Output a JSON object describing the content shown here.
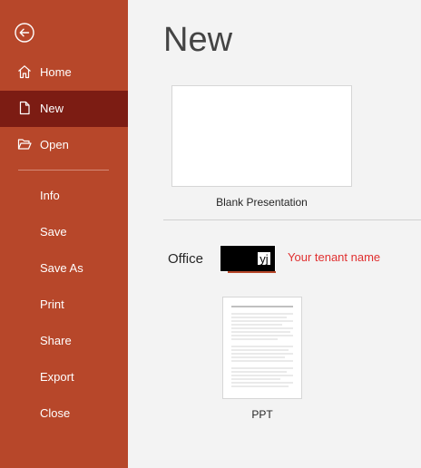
{
  "colors": {
    "sidebar": "#b7472a",
    "sidebar_active": "#7c1c13",
    "main_bg": "#f3f3f3",
    "annotation": "#e03030"
  },
  "sidebar": {
    "back_icon": "back-arrow-circle-icon",
    "items": [
      {
        "label": "Home",
        "icon": "home-icon"
      },
      {
        "label": "New",
        "icon": "document-icon",
        "active": true
      },
      {
        "label": "Open",
        "icon": "folder-open-icon"
      },
      {
        "label": "Info"
      },
      {
        "label": "Save"
      },
      {
        "label": "Save As"
      },
      {
        "label": "Print"
      },
      {
        "label": "Share"
      },
      {
        "label": "Export"
      },
      {
        "label": "Close"
      }
    ]
  },
  "main": {
    "title": "New",
    "blank_template": {
      "caption": "Blank Presentation"
    },
    "tabs": [
      {
        "label": "Office"
      },
      {
        "label": "yj",
        "note": "redacted"
      }
    ],
    "annotation": "Your tenant name",
    "templates": [
      {
        "caption": "PPT"
      }
    ]
  }
}
